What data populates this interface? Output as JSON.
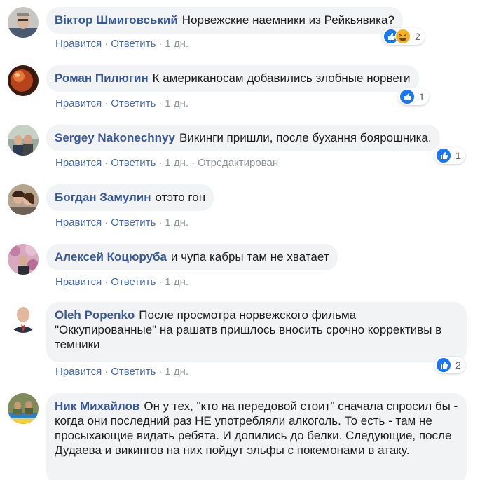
{
  "comments": [
    {
      "author": "Віктор Шмиговський",
      "text": "Норвежские наемники из Рейкьявика?",
      "like": "Нравится",
      "reply": "Ответить",
      "time": "1 дн.",
      "edited": "",
      "reactions": [
        "like-icon",
        "haha-icon"
      ],
      "reaction_count": "2"
    },
    {
      "author": "Роман Пилюгин",
      "text": "К американосам добавились злобные норвеги",
      "like": "Нравится",
      "reply": "Ответить",
      "time": "1 дн.",
      "edited": "",
      "reactions": [
        "like-icon"
      ],
      "reaction_count": "1"
    },
    {
      "author": "Sergey Nakonechnyy",
      "text": "Викинги пришли, после бухання боярошника.",
      "like": "Нравится",
      "reply": "Ответить",
      "time": "1 дн.",
      "edited": "Отредактирован",
      "reactions": [
        "like-icon"
      ],
      "reaction_count": "1"
    },
    {
      "author": "Богдан Замулин",
      "text": "отэто гон",
      "like": "Нравится",
      "reply": "Ответить",
      "time": "1 дн.",
      "edited": "",
      "reactions": [],
      "reaction_count": ""
    },
    {
      "author": "Алексей Коцюруба",
      "text": "и чупа кабры там не хватает",
      "like": "Нравится",
      "reply": "Ответить",
      "time": "1 дн.",
      "edited": "",
      "reactions": [],
      "reaction_count": ""
    },
    {
      "author": "Oleh Popenko",
      "text": "После просмотра норвежского фильма \"Оккупированные\" на рашатв пришлось вносить срочно коррективы в темники",
      "like": "Нравится",
      "reply": "Ответить",
      "time": "1 дн.",
      "edited": "",
      "reactions": [
        "like-icon"
      ],
      "reaction_count": "2"
    },
    {
      "author": "Ник Михайлов",
      "text": "Он у тех, \"кто на передовой стоит\" сначала спросил бы - когда они последний раз НЕ употребляли алкоголь. То есть - там не просыхающие видать ребята. И допились до белки. Следующие, после Дудаева и викингов на них пойдут эльфы с покемонами в атаку.",
      "like": "",
      "reply": "",
      "time": "",
      "edited": "",
      "reactions": [],
      "reaction_count": ""
    }
  ],
  "colors": {
    "author": "#385898",
    "link": "#4267b2",
    "bubble": "#f2f3f5",
    "like": "#1877f2",
    "haha": "#f7b125"
  }
}
